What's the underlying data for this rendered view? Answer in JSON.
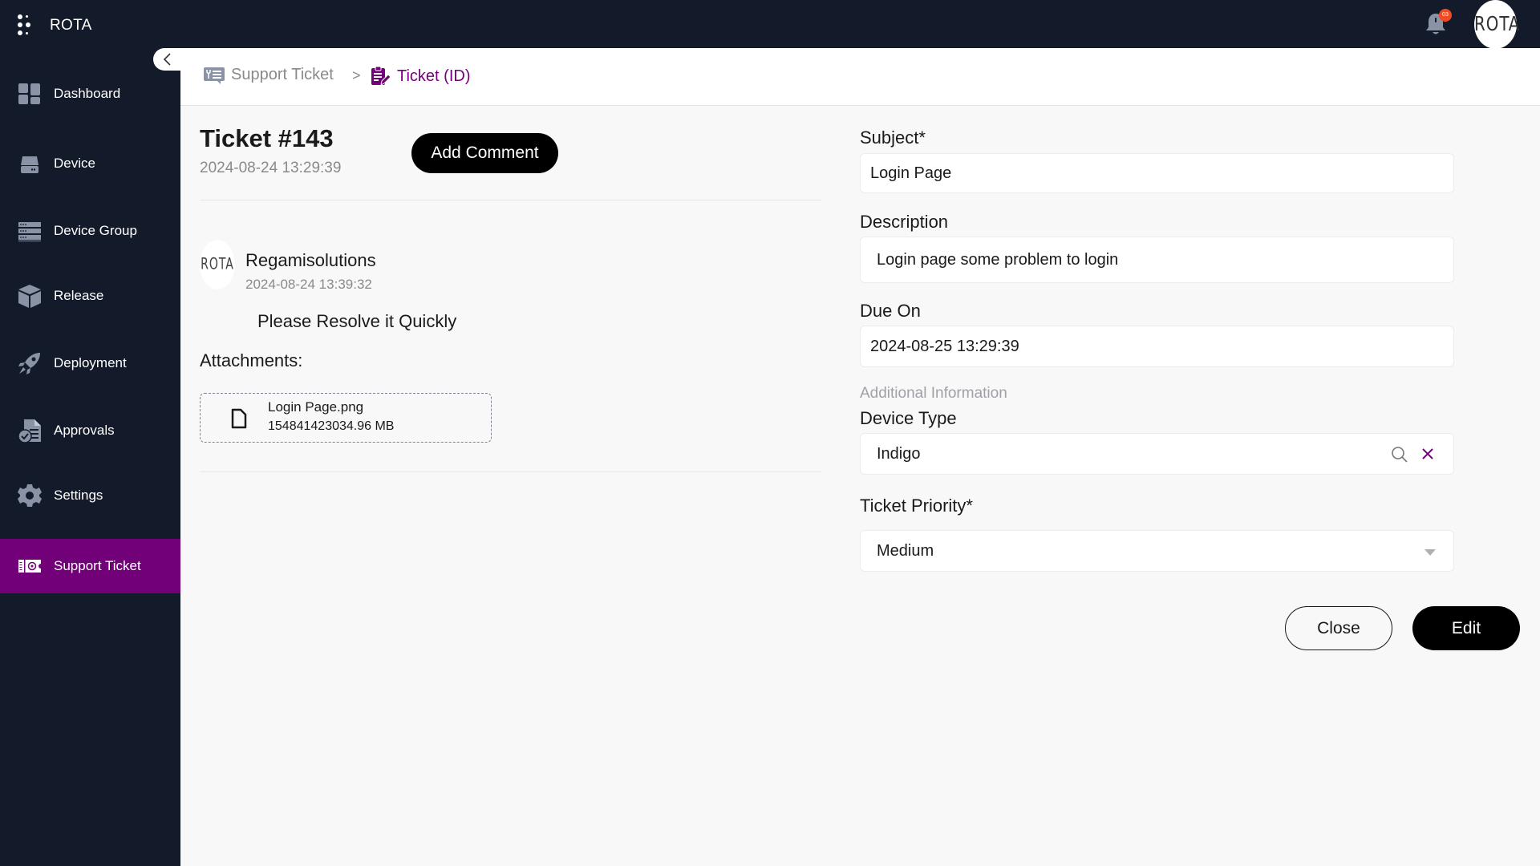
{
  "app": {
    "title": "ROTA",
    "notification_count": "03",
    "avatar_text": "ROTA"
  },
  "sidebar": {
    "items": [
      {
        "label": "Dashboard",
        "icon": "dashboard-icon"
      },
      {
        "label": "Device",
        "icon": "device-icon"
      },
      {
        "label": "Device Group",
        "icon": "device-group-icon"
      },
      {
        "label": "Release",
        "icon": "release-box-icon"
      },
      {
        "label": "Deployment",
        "icon": "rocket-icon"
      },
      {
        "label": "Approvals",
        "icon": "approvals-icon"
      },
      {
        "label": "Settings",
        "icon": "gear-icon"
      },
      {
        "label": "Support Ticket",
        "icon": "ticket-icon",
        "active": true
      }
    ]
  },
  "colors": {
    "sidebar_bg": "#131a2a",
    "accent": "#720078",
    "badge": "#f04b23"
  },
  "breadcrumb": {
    "items": [
      {
        "label": "Support Ticket",
        "icon": "support-ticket-icon"
      },
      {
        "label": "Ticket (ID)",
        "icon": "clipboard-edit-icon"
      }
    ],
    "separator": ">"
  },
  "ticket": {
    "title": "Ticket #143",
    "created": "2024-08-24 13:29:39",
    "add_comment_label": "Add Comment"
  },
  "comments": [
    {
      "avatar_text": "ROTA",
      "author": "Regamisolutions",
      "date": "2024-08-24 13:39:32",
      "text": "Please Resolve it Quickly"
    }
  ],
  "attachments": {
    "label": "Attachments:",
    "items": [
      {
        "name": "Login Page.png",
        "size": "154841423034.96 MB"
      }
    ]
  },
  "form": {
    "subject": {
      "label": "Subject*",
      "value": "Login Page"
    },
    "description": {
      "label": "Description",
      "value": "Login page some problem to login"
    },
    "due_on": {
      "label": "Due On",
      "value": "2024-08-25 13:29:39"
    },
    "additional_info_label": "Additional Information",
    "device_type": {
      "label": "Device Type",
      "value": "Indigo"
    },
    "priority": {
      "label": "Ticket Priority*",
      "value": "Medium"
    },
    "close_label": "Close",
    "edit_label": "Edit"
  }
}
